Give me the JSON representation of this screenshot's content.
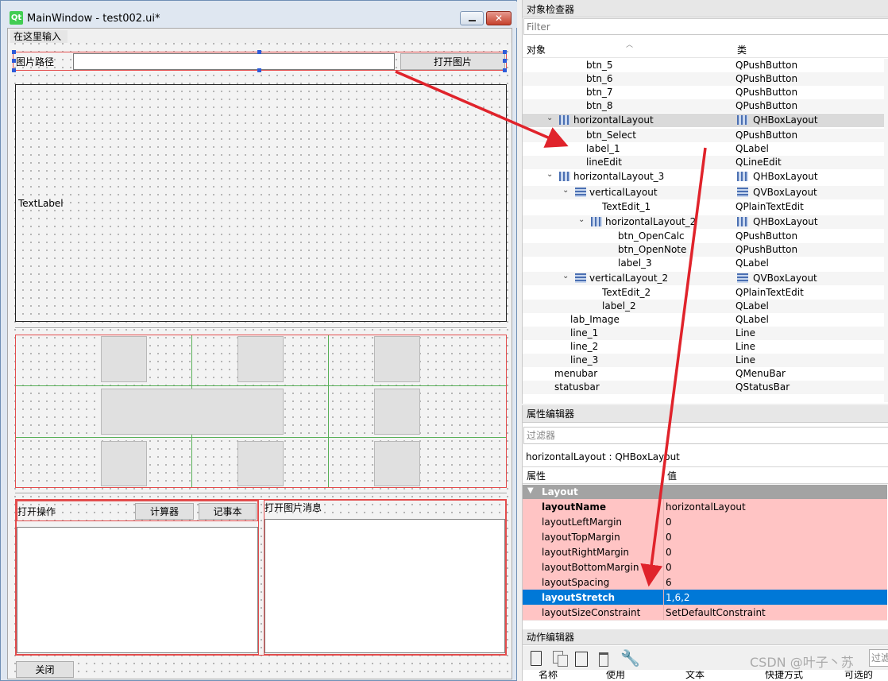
{
  "window": {
    "title": "MainWindow - test002.ui*",
    "menu_placeholder": "在这里输入",
    "path_label": "图片路径",
    "open_image_button": "打开图片",
    "text_label": "TextLabel",
    "open_ops_label": "打开操作",
    "calc_button": "计算器",
    "notepad_button": "记事本",
    "open_image_msg_label": "打开图片消息",
    "close_button": "关闭"
  },
  "object_inspector": {
    "title": "对象检查器",
    "filter_placeholder": "Filter",
    "col_object": "对象",
    "col_class": "类",
    "rows": [
      {
        "name": "btn_5",
        "cls": "QPushButton"
      },
      {
        "name": "btn_6",
        "cls": "QPushButton"
      },
      {
        "name": "btn_7",
        "cls": "QPushButton"
      },
      {
        "name": "btn_8",
        "cls": "QPushButton"
      },
      {
        "name": "horizontalLayout",
        "cls": "QHBoxLayout"
      },
      {
        "name": "btn_Select",
        "cls": "QPushButton"
      },
      {
        "name": "label_1",
        "cls": "QLabel"
      },
      {
        "name": "lineEdit",
        "cls": "QLineEdit"
      },
      {
        "name": "horizontalLayout_3",
        "cls": "QHBoxLayout"
      },
      {
        "name": "verticalLayout",
        "cls": "QVBoxLayout"
      },
      {
        "name": "TextEdit_1",
        "cls": "QPlainTextEdit"
      },
      {
        "name": "horizontalLayout_2",
        "cls": "QHBoxLayout"
      },
      {
        "name": "btn_OpenCalc",
        "cls": "QPushButton"
      },
      {
        "name": "btn_OpenNote",
        "cls": "QPushButton"
      },
      {
        "name": "label_3",
        "cls": "QLabel"
      },
      {
        "name": "verticalLayout_2",
        "cls": "QVBoxLayout"
      },
      {
        "name": "TextEdit_2",
        "cls": "QPlainTextEdit"
      },
      {
        "name": "label_2",
        "cls": "QLabel"
      },
      {
        "name": "lab_Image",
        "cls": "QLabel"
      },
      {
        "name": "line_1",
        "cls": "Line"
      },
      {
        "name": "line_2",
        "cls": "Line"
      },
      {
        "name": "line_3",
        "cls": "Line"
      },
      {
        "name": "menubar",
        "cls": "QMenuBar"
      },
      {
        "name": "statusbar",
        "cls": "QStatusBar"
      }
    ]
  },
  "property_editor": {
    "title": "属性编辑器",
    "filter_placeholder": "过滤器",
    "object_line": "horizontalLayout : QHBoxLayout",
    "col_property": "属性",
    "col_value": "值",
    "group": "Layout",
    "rows": [
      {
        "name": "layoutName",
        "value": "horizontalLayout"
      },
      {
        "name": "layoutLeftMargin",
        "value": "0"
      },
      {
        "name": "layoutTopMargin",
        "value": "0"
      },
      {
        "name": "layoutRightMargin",
        "value": "0"
      },
      {
        "name": "layoutBottomMargin",
        "value": "0"
      },
      {
        "name": "layoutSpacing",
        "value": "6"
      },
      {
        "name": "layoutStretch",
        "value": "1,6,2"
      },
      {
        "name": "layoutSizeConstraint",
        "value": "SetDefaultConstraint"
      }
    ]
  },
  "action_editor": {
    "title": "动作编辑器",
    "filter_placeholder": "过滤",
    "columns": [
      "名称",
      "使用",
      "文本",
      "快捷方式",
      "可选的"
    ]
  },
  "watermark": "CSDN @叶子丶苏",
  "colors": {
    "selection": "#0078d7",
    "layout_red": "#e34d4d",
    "arrow_red": "#e0232b",
    "grid_green": "#58b058"
  }
}
